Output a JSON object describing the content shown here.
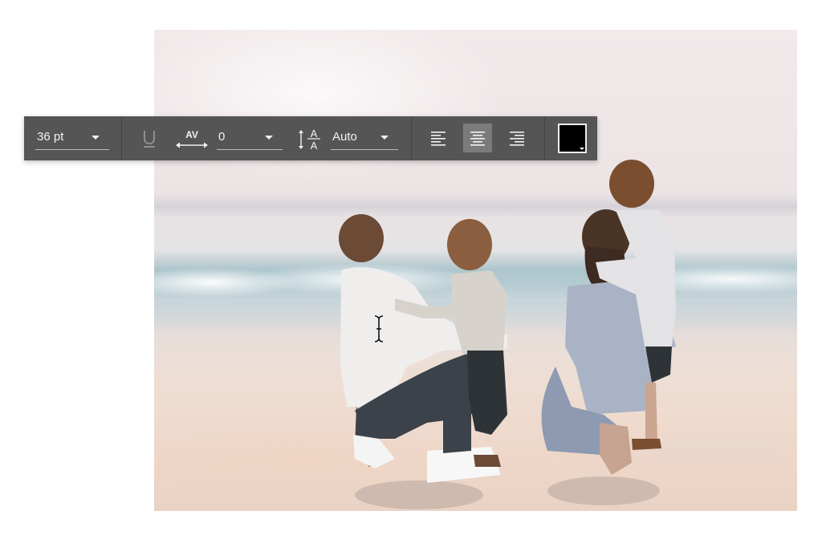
{
  "toolbar": {
    "font_size": {
      "value": "36 pt"
    },
    "underline_icon": "underline-icon",
    "letter_spacing": {
      "icon": "letter-spacing-icon",
      "icon_text": "AV",
      "value": "0"
    },
    "line_height": {
      "icon": "line-height-icon",
      "icon_text": "A",
      "value": "Auto"
    },
    "alignment": {
      "options": [
        "align-left",
        "align-center",
        "align-right"
      ],
      "selected": "align-center"
    },
    "text_color": {
      "icon": "color-swatch",
      "value": "#000000"
    }
  },
  "canvas": {
    "image_semantic": "family-on-beach-photo",
    "cursor_icon": "text-cursor-icon"
  },
  "colors": {
    "toolbar_bg": "#555555",
    "active_button": "#7b7b7b",
    "divider": "#444444"
  }
}
